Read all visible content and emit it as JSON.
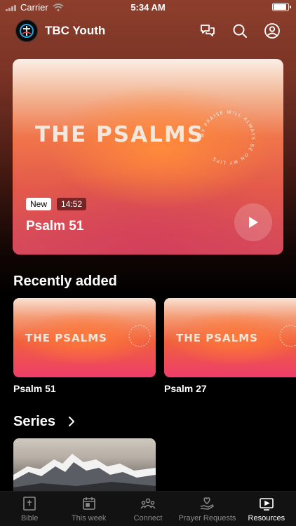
{
  "status": {
    "carrier": "Carrier",
    "time": "5:34 AM"
  },
  "header": {
    "title": "TBC Youth",
    "icons": [
      "chat-icon",
      "search-icon",
      "profile-icon"
    ]
  },
  "hero": {
    "artwork_text": "THE PSALMS",
    "artwork_ring_text": "MY PRAISE WILL ALWAYS BE ON MY LIPS",
    "badge_new": "New",
    "duration": "14:52",
    "title": "Psalm 51"
  },
  "recent": {
    "heading": "Recently added",
    "items": [
      {
        "artwork_text": "THE PSALMS",
        "title": "Psalm 51"
      },
      {
        "artwork_text": "THE PSALMS",
        "title": "Psalm 27"
      }
    ]
  },
  "series": {
    "heading": "Series"
  },
  "tabs": [
    {
      "label": "Bible",
      "icon": "bible-icon",
      "active": false
    },
    {
      "label": "This week",
      "icon": "calendar-icon",
      "active": false
    },
    {
      "label": "Connect",
      "icon": "people-icon",
      "active": false
    },
    {
      "label": "Prayer Requests",
      "icon": "prayer-hand-icon",
      "active": false
    },
    {
      "label": "Resources",
      "icon": "play-screen-icon",
      "active": true
    }
  ]
}
